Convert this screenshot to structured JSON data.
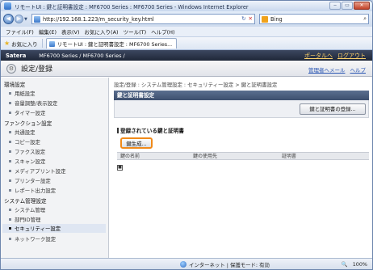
{
  "window": {
    "title": "リモートUI : 鍵と証明書設定 : MF6700 Series : MF6700 Series - Windows Internet Explorer",
    "minimize": "‒",
    "maximize": "▭",
    "close": "✕"
  },
  "address": {
    "url": "http://192.168.1.223/m_security_key.html",
    "refresh": "↻",
    "stop": "✕"
  },
  "search": {
    "value": "Bing",
    "go": "⌕"
  },
  "menu": [
    "ファイル(F)",
    "編集(E)",
    "表示(V)",
    "お気に入り(A)",
    "ツール(T)",
    "ヘルプ(H)"
  ],
  "favorites": {
    "label": "お気に入り",
    "tab": "リモートUI : 鍵と証明書設定 : MF6700 Series..."
  },
  "satera": {
    "brand": "Satera",
    "model": "MF6700 Series / MF6700 Series /",
    "portal": "ポータルへ",
    "logout": "ログアウト"
  },
  "header": {
    "title": "設定/登録",
    "mail": "管理者へメール",
    "help": "ヘルプ"
  },
  "sidebar": {
    "sections": [
      {
        "title": "環境設定",
        "items": [
          "用紙設定",
          "音量調整/表示設定",
          "タイマー設定"
        ]
      },
      {
        "title": "ファンクション設定",
        "items": [
          "共通設定",
          "コピー設定",
          "ファクス設定",
          "スキャン設定",
          "メディアプリント設定",
          "プリンター設定",
          "レポート出力設定"
        ]
      },
      {
        "title": "システム管理設定",
        "items": [
          "システム管理",
          "部門ID管理",
          "セキュリティー設定",
          "ネットワーク設定"
        ]
      }
    ]
  },
  "main": {
    "breadcrumb": "設定/登録 : システム管理設定 : セキュリティー設定 > 鍵と証明書設定",
    "panel_title": "鍵と証明書設定",
    "register_button": "鍵と証明書の登録...",
    "section_title": "登録されている鍵と証明書",
    "generate_button": "鍵生成...",
    "table_headers": [
      "鍵の名前",
      "鍵の使用先",
      "証明書"
    ],
    "empty_marker": "■"
  },
  "status": {
    "zone": "インターネット | 保護モード: 有効",
    "zoom": "100%"
  }
}
